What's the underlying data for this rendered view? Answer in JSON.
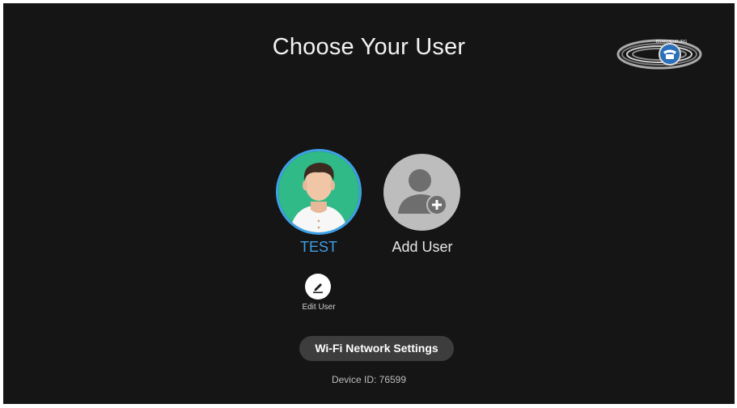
{
  "header": {
    "title": "Choose Your User",
    "logo_icon": "brandenburg-phone-logo",
    "logo_text": "BRANDENBURG"
  },
  "users": [
    {
      "name": "TEST",
      "avatar_icon": "user-portrait-avatar",
      "selected": true
    },
    {
      "name": "Add User",
      "avatar_icon": "add-user-icon"
    }
  ],
  "edit_user": {
    "label": "Edit User",
    "icon": "pencil-icon"
  },
  "wifi": {
    "label": "Wi-Fi Network Settings"
  },
  "footer": {
    "device_id": "Device ID: 76599"
  },
  "colors": {
    "background": "#151515",
    "accent": "#3fa0e8",
    "avatar_green": "#2fba87",
    "button_bg": "#3d3d3d"
  }
}
